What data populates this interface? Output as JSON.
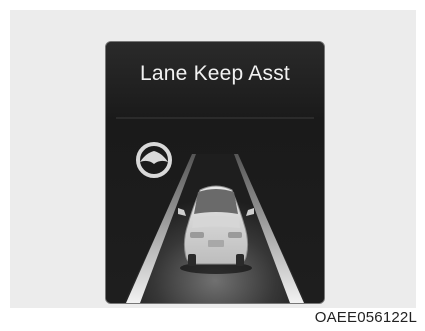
{
  "display": {
    "title": "Lane Keep Asst",
    "status_icon": "steering-wheel-icon"
  },
  "figure_code": "OAEE056122L",
  "colors": {
    "screen_background": "#1e1e1e",
    "panel_background": "#ececec",
    "text": "#f2f2f2"
  }
}
